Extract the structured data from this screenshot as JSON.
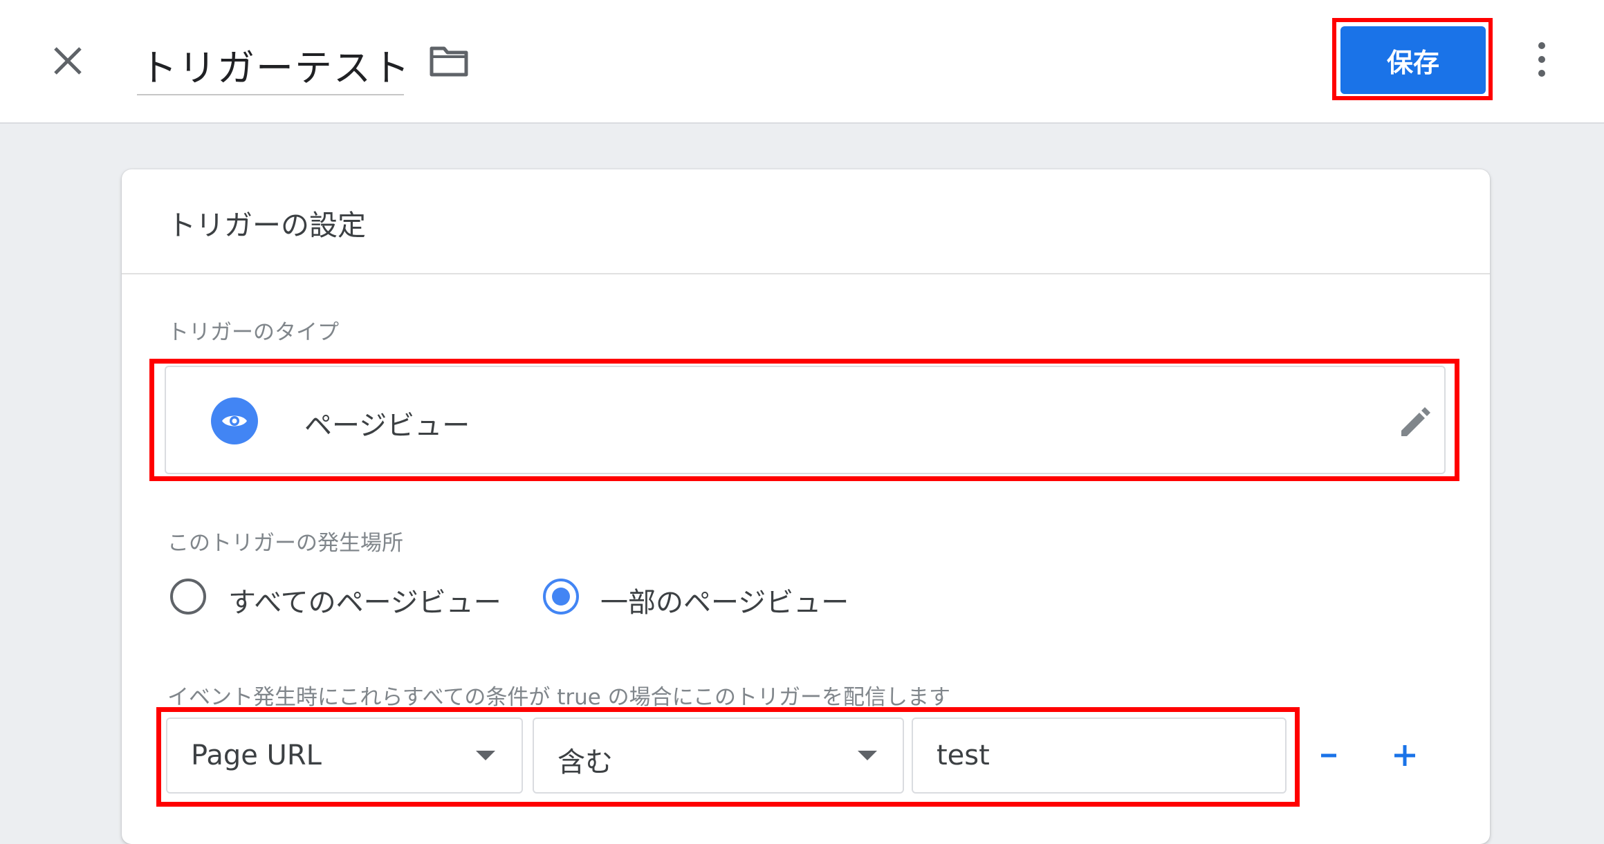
{
  "header": {
    "title": "トリガーテスト",
    "save_label": "保存"
  },
  "card": {
    "title": "トリガーの設定",
    "type_section_label": "トリガーのタイプ",
    "trigger_type": "ページビュー",
    "fire_on_label": "このトリガーの発生場所",
    "fire_options": [
      {
        "label": "すべてのページビュー",
        "selected": false
      },
      {
        "label": "一部のページビュー",
        "selected": true
      }
    ],
    "condition_label": "イベント発生時にこれらすべての条件が true の場合にこのトリガーを配信します",
    "condition": {
      "variable": "Page URL",
      "operator": "含む",
      "value": "test"
    },
    "minus_label": "-",
    "plus_label": "+"
  },
  "colors": {
    "accent": "#1a73e8",
    "highlight": "#ff0000",
    "icon_blue": "#4285f4"
  },
  "icons": [
    "close-icon",
    "folder-icon",
    "more-vert-icon",
    "eye-icon",
    "pencil-icon",
    "dropdown-arrow-icon"
  ]
}
